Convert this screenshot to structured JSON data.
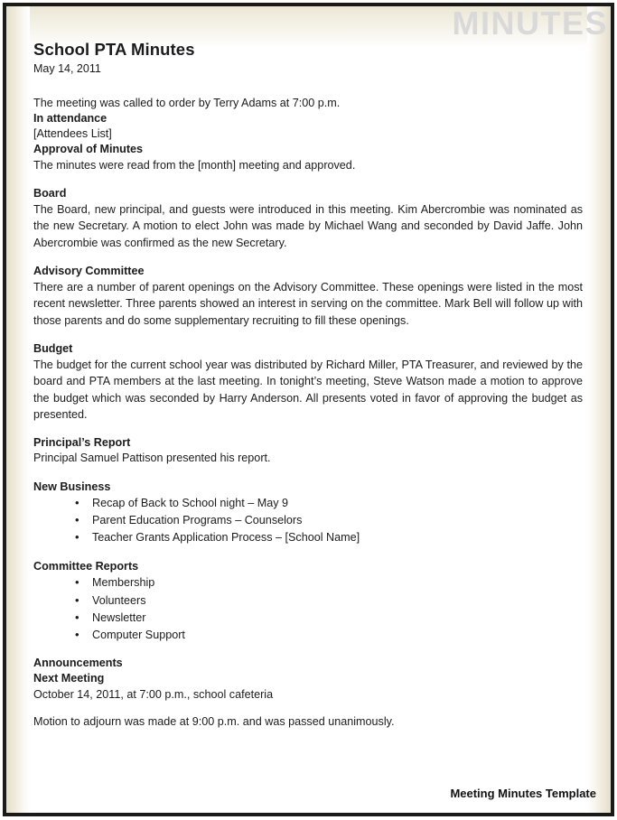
{
  "watermark": "MINUTES",
  "document": {
    "title": "School PTA Minutes",
    "date": "May 14, 2011",
    "intro": "The meeting was called to order by Terry Adams at 7:00 p.m.",
    "attendance_heading": "In attendance",
    "attendance_value": "[Attendees List]",
    "approval_heading": "Approval of Minutes",
    "approval_text": "The minutes were read from the [month] meeting and approved.",
    "sections": [
      {
        "heading": "Board",
        "body": "The Board, new principal, and guests were introduced in this meeting. Kim Abercrombie was nominated as the new Secretary. A motion to elect John was made by Michael Wang and seconded by David Jaffe. John Abercrombie was confirmed as the new Secretary."
      },
      {
        "heading": "Advisory Committee",
        "body": "There are a number of parent openings on the Advisory Committee. These openings were listed in the most recent newsletter. Three parents showed an interest in serving on the committee. Mark Bell will follow up with those parents and do some supplementary recruiting to fill these openings."
      },
      {
        "heading": "Budget",
        "body": "The budget for the current school year was distributed by Richard Miller, PTA Treasurer, and reviewed by the board and PTA members at the last meeting. In tonight’s meeting, Steve Watson made a motion to approve the budget which was seconded by Harry Anderson. All presents voted in favor of approving the budget as presented."
      },
      {
        "heading": "Principal’s Report",
        "body": "Principal Samuel Pattison presented his report."
      }
    ],
    "new_business": {
      "heading": "New Business",
      "items": [
        "Recap of Back to School night – May 9",
        "Parent Education Programs – Counselors",
        "Teacher Grants Application Process – [School Name]"
      ]
    },
    "committee_reports": {
      "heading": "Committee Reports",
      "items": [
        "Membership",
        "Volunteers",
        "Newsletter",
        "Computer Support"
      ]
    },
    "announcements_heading": "Announcements",
    "next_meeting_heading": "Next Meeting",
    "next_meeting_value": "October 14, 2011, at 7:00 p.m., school cafeteria",
    "adjourn_text": "Motion to adjourn was made at 9:00 p.m. and was passed unanimously."
  },
  "footer": {
    "label": "Meeting Minutes Template"
  },
  "colors": {
    "border": "#1a1a18",
    "watermark": "#d9d9d9",
    "wash": "#e4dfcb",
    "text": "#1b1b1b"
  }
}
